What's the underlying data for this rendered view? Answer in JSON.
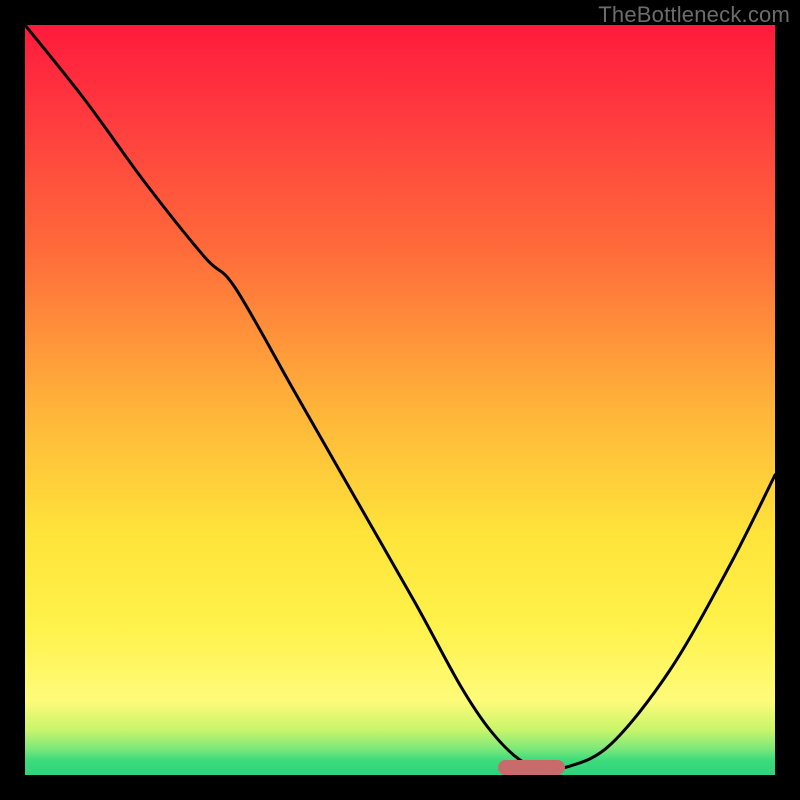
{
  "watermark": "TheBottleneck.com",
  "colors": {
    "frame": "#000000",
    "curve": "#000000",
    "marker": "#c96b6b"
  },
  "chart_data": {
    "type": "line",
    "title": "",
    "xlabel": "",
    "ylabel": "",
    "xlim": [
      0,
      100
    ],
    "ylim": [
      0,
      100
    ],
    "grid": false,
    "legend": false,
    "note": "values estimated from pixel positions; x,y in percent of plot area (y=0 at bottom)",
    "series": [
      {
        "name": "bottleneck-curve",
        "x": [
          0,
          8,
          16,
          24,
          28,
          36,
          44,
          52,
          58,
          62,
          66,
          69,
          72,
          78,
          86,
          94,
          100
        ],
        "y": [
          100,
          90,
          79,
          69,
          65,
          51,
          37,
          23,
          12,
          6,
          2,
          1,
          1,
          4,
          14,
          28,
          40
        ]
      }
    ],
    "optimal_range": {
      "x_start": 63,
      "x_end": 72,
      "y": 1
    }
  }
}
